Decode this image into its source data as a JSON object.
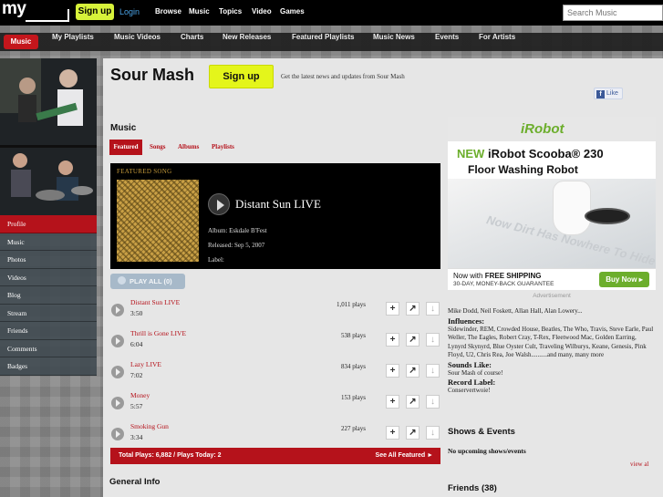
{
  "topbar": {
    "logo": "my",
    "signup": "Sign up",
    "login": "Login",
    "nav": [
      "Browse",
      "Music",
      "Topics",
      "Video",
      "Games"
    ],
    "search_placeholder": "Search Music"
  },
  "nav2": [
    "Music",
    "My Playlists",
    "Music Videos",
    "Charts",
    "New Releases",
    "Featured Playlists",
    "Music News",
    "Events",
    "For Artists"
  ],
  "leftnav": [
    "Profile",
    "Music",
    "Photos",
    "Videos",
    "Blog",
    "Stream",
    "Friends",
    "Comments",
    "Badges"
  ],
  "header": {
    "band_name": "Sour Mash",
    "signup": "Sign up",
    "tagline": "Get the latest news and updates from Sour Mash",
    "like": "Like"
  },
  "music": {
    "heading": "Music",
    "tabs": [
      "Featured",
      "Songs",
      "Albums",
      "Playlists"
    ],
    "featured": {
      "label": "FEATURED SONG",
      "title": "Distant Sun LIVE",
      "album": "Album: Eskdale B'Fest",
      "released": "Released: Sep 5, 2007",
      "label_field": "Label:"
    },
    "play_all": "PLAY ALL (0)",
    "tracks": [
      {
        "title": "Distant Sun LIVE",
        "duration": "3:50",
        "plays": "1,011 plays"
      },
      {
        "title": "Thrill is Gone LIVE",
        "duration": "6:04",
        "plays": "538 plays"
      },
      {
        "title": "Lazy LIVE",
        "duration": "7:02",
        "plays": "834 plays"
      },
      {
        "title": "Money",
        "duration": "5:57",
        "plays": "153 plays"
      },
      {
        "title": "Smoking Gun",
        "duration": "3:34",
        "plays": "227 plays"
      }
    ],
    "totals": "Total Plays: 6,882 / Plays Today: 2",
    "see_all": "See All Featured ►"
  },
  "general_info": "General Info",
  "ad": {
    "brand": "iRobot",
    "headline_new": "NEW",
    "headline": "iRobot Scooba® 230",
    "sub": "Floor Washing Robot",
    "slogan": "Now Dirt Has Nowhere To Hide",
    "ship_pre": "Now with ",
    "ship_bold": "FREE SHIPPING",
    "guarantee": "30-DAY, MONEY-BACK GUARANTEE",
    "buy": "Buy Now ▸",
    "label": "Advertisement"
  },
  "info": {
    "members": "Mike Dodd, Neil Foskett, Allan Hall, Alan Lowery...",
    "influences_h": "Influences:",
    "influences": "Sidewinder, REM, Crowded House, Beatles, The Who, Travis, Steve Earle, Paul Weller, The Eagles, Robert Cray, T-Rex, Fleetwood Mac, Golden Earring, Lynyrd Skynyrd, Blue Oyster Cult, Traveling Wilburys, Keane, Genesis, Pink Floyd, U2, Chris Rea, Joe Walsh..........and many, many more",
    "sounds_h": "Sounds Like:",
    "sounds": "Sour Mash of course!",
    "record_h": "Record Label:",
    "record": "Conservertwoie!"
  },
  "shows": {
    "heading": "Shows & Events",
    "none": "No upcoming shows/events",
    "view_all": "view al"
  },
  "friends": "Friends (38)"
}
